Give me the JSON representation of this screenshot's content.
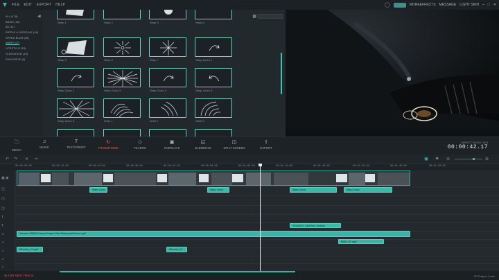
{
  "menu": {
    "items": [
      "FILE",
      "EDIT",
      "EXPORT",
      "HELP"
    ],
    "register": "",
    "moreeffects": "MOREEFFECTS",
    "message": "MESSAGE",
    "theme": "LIGHT SKIN"
  },
  "sidebar": {
    "items": [
      "ALL (178)",
      "BASIC (18)",
      "3D (11)",
      "RIPPLE & DISSOLVE (18)",
      "SPEED BLUR (16)",
      "WARP (27)",
      "LIFESTYLE (15)",
      "SLIDESHOW (15)",
      "FAVOURITE (0)"
    ],
    "active_index": 5
  },
  "transitions": {
    "row0": [
      "Warp 1",
      "Warp 2",
      "Warp 3",
      "Warp 4"
    ],
    "row1": [
      "Warp 5",
      "Warp 6",
      "Warp 7",
      "Warp Zoom 1"
    ],
    "row2": [
      "Warp Zoom 2",
      "Warp Zoom 3",
      "Warp Zoom 4",
      "Warp Zoom 5"
    ],
    "row3": [
      "Warp Zoom 6",
      "Whirl 1",
      "Whirl 2",
      "Whirl 3"
    ]
  },
  "toolbar": {
    "media": "MEDIA",
    "music": "MUSIC",
    "text": "TEXT/CREDIT",
    "transitions": "TRANSITIONS",
    "filters": "FILTERS",
    "overlays": "OVERLAYS",
    "elements": "ELEMENTS",
    "split": "SPLIT SCREEN",
    "export": "EXPORT"
  },
  "timecode": {
    "label": "ASPECT RATIO: 16:9",
    "value": "00:00:42.17"
  },
  "ruler": [
    "00:00:00.00",
    "00:00:10.00",
    "00:00:20.00",
    "00:00:30.00",
    "00:00:40.00",
    "00:00:50.00",
    "00:01:00.00",
    "00:01:10.00",
    "00:01:20.00",
    "00:01:30.00",
    "00:01:40.00",
    "00:01:50.00"
  ],
  "clips": {
    "t1": "Warp Zoom",
    "t2": "Warp Zoom",
    "t3": "Warp Zoom",
    "t4": "Warp Zoom",
    "ov1": "20160415_ClipFinal_Youtube",
    "audio1": "Yamaha XS650 Custom Engine Start MotorcycleSound.mp3",
    "audio2": "BMW_01.mp3",
    "sfx1": "Whoosh_01.mp3",
    "sfx2": "Whoosh_02"
  },
  "bottom": {
    "add_track": "ADD NEW TRACK",
    "project": "YE Project 4.wve"
  },
  "colors": {
    "accent": "#3cb7a8",
    "active": "#e26d5c"
  }
}
